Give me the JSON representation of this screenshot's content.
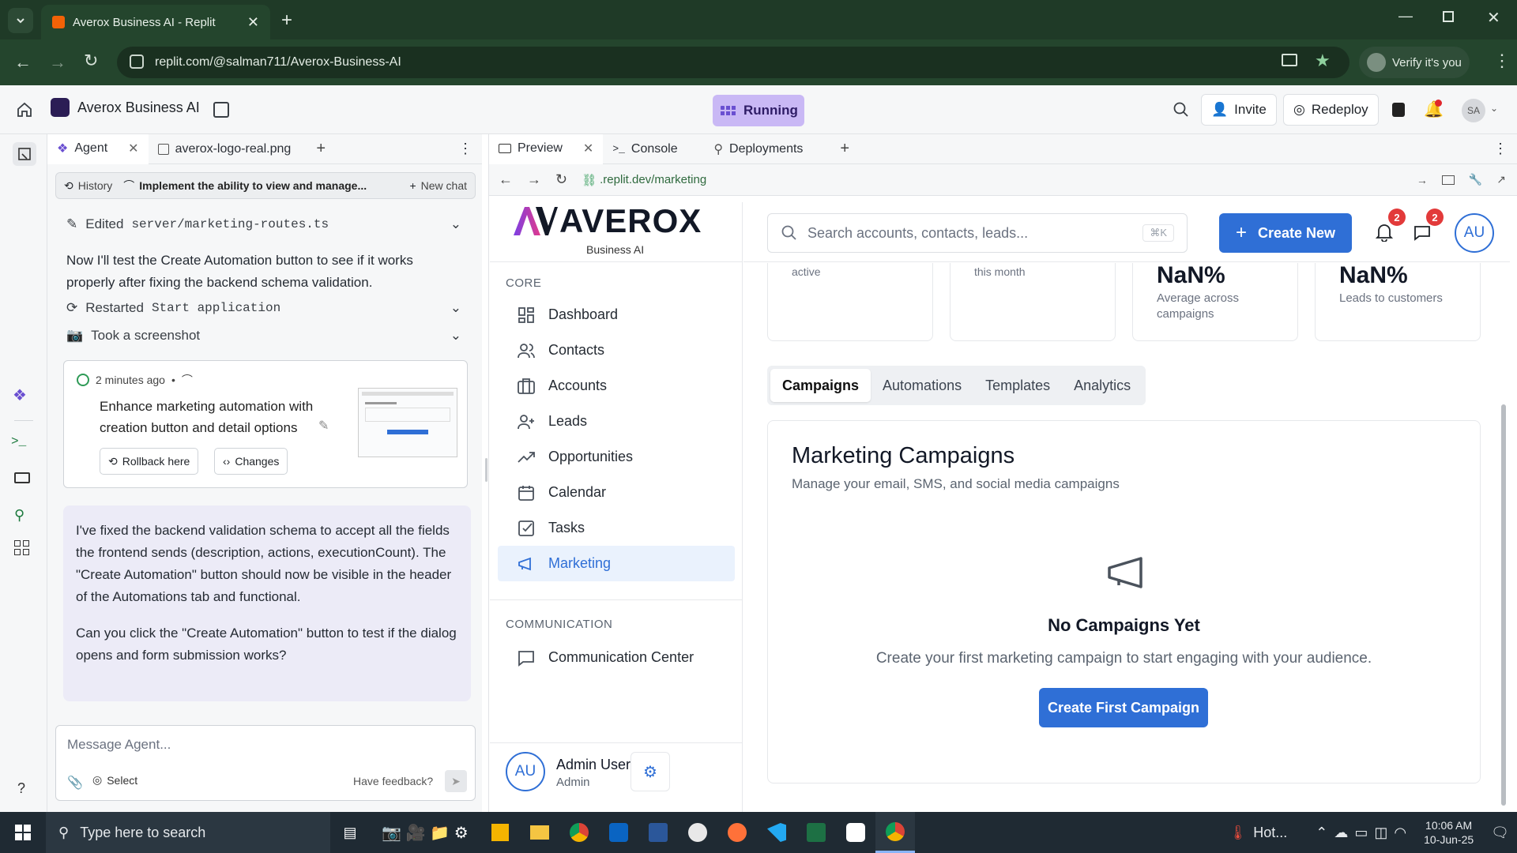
{
  "browser": {
    "tab_title": "Averox Business AI - Replit",
    "url": "replit.com/@salman711/Averox-Business-AI",
    "verify_label": "Verify it's you"
  },
  "replit": {
    "project_name": "Averox Business AI",
    "status": "Running",
    "invite_label": "Invite",
    "redeploy_label": "Redeploy",
    "avatar_initials": "SA"
  },
  "agent_panel": {
    "tabs": [
      {
        "label": "Agent"
      },
      {
        "label": "averox-logo-real.png"
      }
    ],
    "history_label": "History",
    "current_task": "Implement the ability to view and manage...",
    "new_chat_label": "New chat",
    "edited_prefix": "Edited",
    "edited_file": "server/marketing-routes.ts",
    "message_1": "Now I'll test the Create Automation button to see if it works properly after fixing the backend schema validation.",
    "restarted_prefix": "Restarted",
    "restarted_target": "Start application",
    "screenshot_label": "Took a screenshot",
    "checkpoint": {
      "time": "2 minutes ago",
      "description": "Enhance marketing automation with creation button and detail options",
      "rollback_label": "Rollback here",
      "changes_label": "Changes"
    },
    "agent_reply_p1": "I've fixed the backend validation schema to accept all the fields the frontend sends (description, actions, executionCount). The \"Create Automation\" button should now be visible in the header of the Automations tab and functional.",
    "agent_reply_p2": "Can you click the \"Create Automation\" button to test if the dialog opens and form submission works?",
    "input_placeholder": "Message Agent...",
    "select_label": "Select",
    "feedback_label": "Have feedback?"
  },
  "preview_panel": {
    "tabs": [
      {
        "label": "Preview"
      },
      {
        "label": "Console"
      },
      {
        "label": "Deployments"
      }
    ],
    "url": ".replit.dev/marketing"
  },
  "app": {
    "logo_text": "AVEROX",
    "logo_sub": "Business AI",
    "search_placeholder": "Search accounts, contacts, leads...",
    "search_shortcut": "⌘K",
    "create_new_label": "Create New",
    "notif_count": "2",
    "msg_count": "2",
    "user_initials": "AU",
    "sidebar": {
      "core_heading": "CORE",
      "items": [
        {
          "label": "Dashboard",
          "icon": "grid-icon"
        },
        {
          "label": "Contacts",
          "icon": "users-icon"
        },
        {
          "label": "Accounts",
          "icon": "building-icon"
        },
        {
          "label": "Leads",
          "icon": "user-plus-icon"
        },
        {
          "label": "Opportunities",
          "icon": "trending-icon"
        },
        {
          "label": "Calendar",
          "icon": "calendar-icon"
        },
        {
          "label": "Tasks",
          "icon": "check-square-icon"
        },
        {
          "label": "Marketing",
          "icon": "megaphone-icon"
        }
      ],
      "comm_heading": "COMMUNICATION",
      "comm_items": [
        {
          "label": "Communication Center",
          "icon": "message-icon"
        }
      ],
      "user_name": "Admin User",
      "user_role": "Admin"
    },
    "stats": [
      {
        "value": "",
        "caption": "active"
      },
      {
        "value": "",
        "caption": "this month"
      },
      {
        "value": "NaN%",
        "caption": "Average across campaigns"
      },
      {
        "value": "NaN%",
        "caption": "Leads to customers"
      }
    ],
    "tabs": [
      {
        "label": "Campaigns"
      },
      {
        "label": "Automations"
      },
      {
        "label": "Templates"
      },
      {
        "label": "Analytics"
      }
    ],
    "section_title": "Marketing Campaigns",
    "section_subtitle": "Manage your email, SMS, and social media campaigns",
    "empty_title": "No Campaigns Yet",
    "empty_text": "Create your first marketing campaign to start engaging with your audience.",
    "empty_button": "Create First Campaign"
  },
  "taskbar": {
    "search_placeholder": "Type here to search",
    "weather": "Hot...",
    "time": "10:06 AM",
    "date": "10-Jun-25"
  },
  "colors": {
    "chrome_bg": "#1f3a27",
    "accent_blue": "#2f6fd6",
    "running_purple": "#c9b8f5",
    "agent_bubble": "#ecebf7"
  }
}
